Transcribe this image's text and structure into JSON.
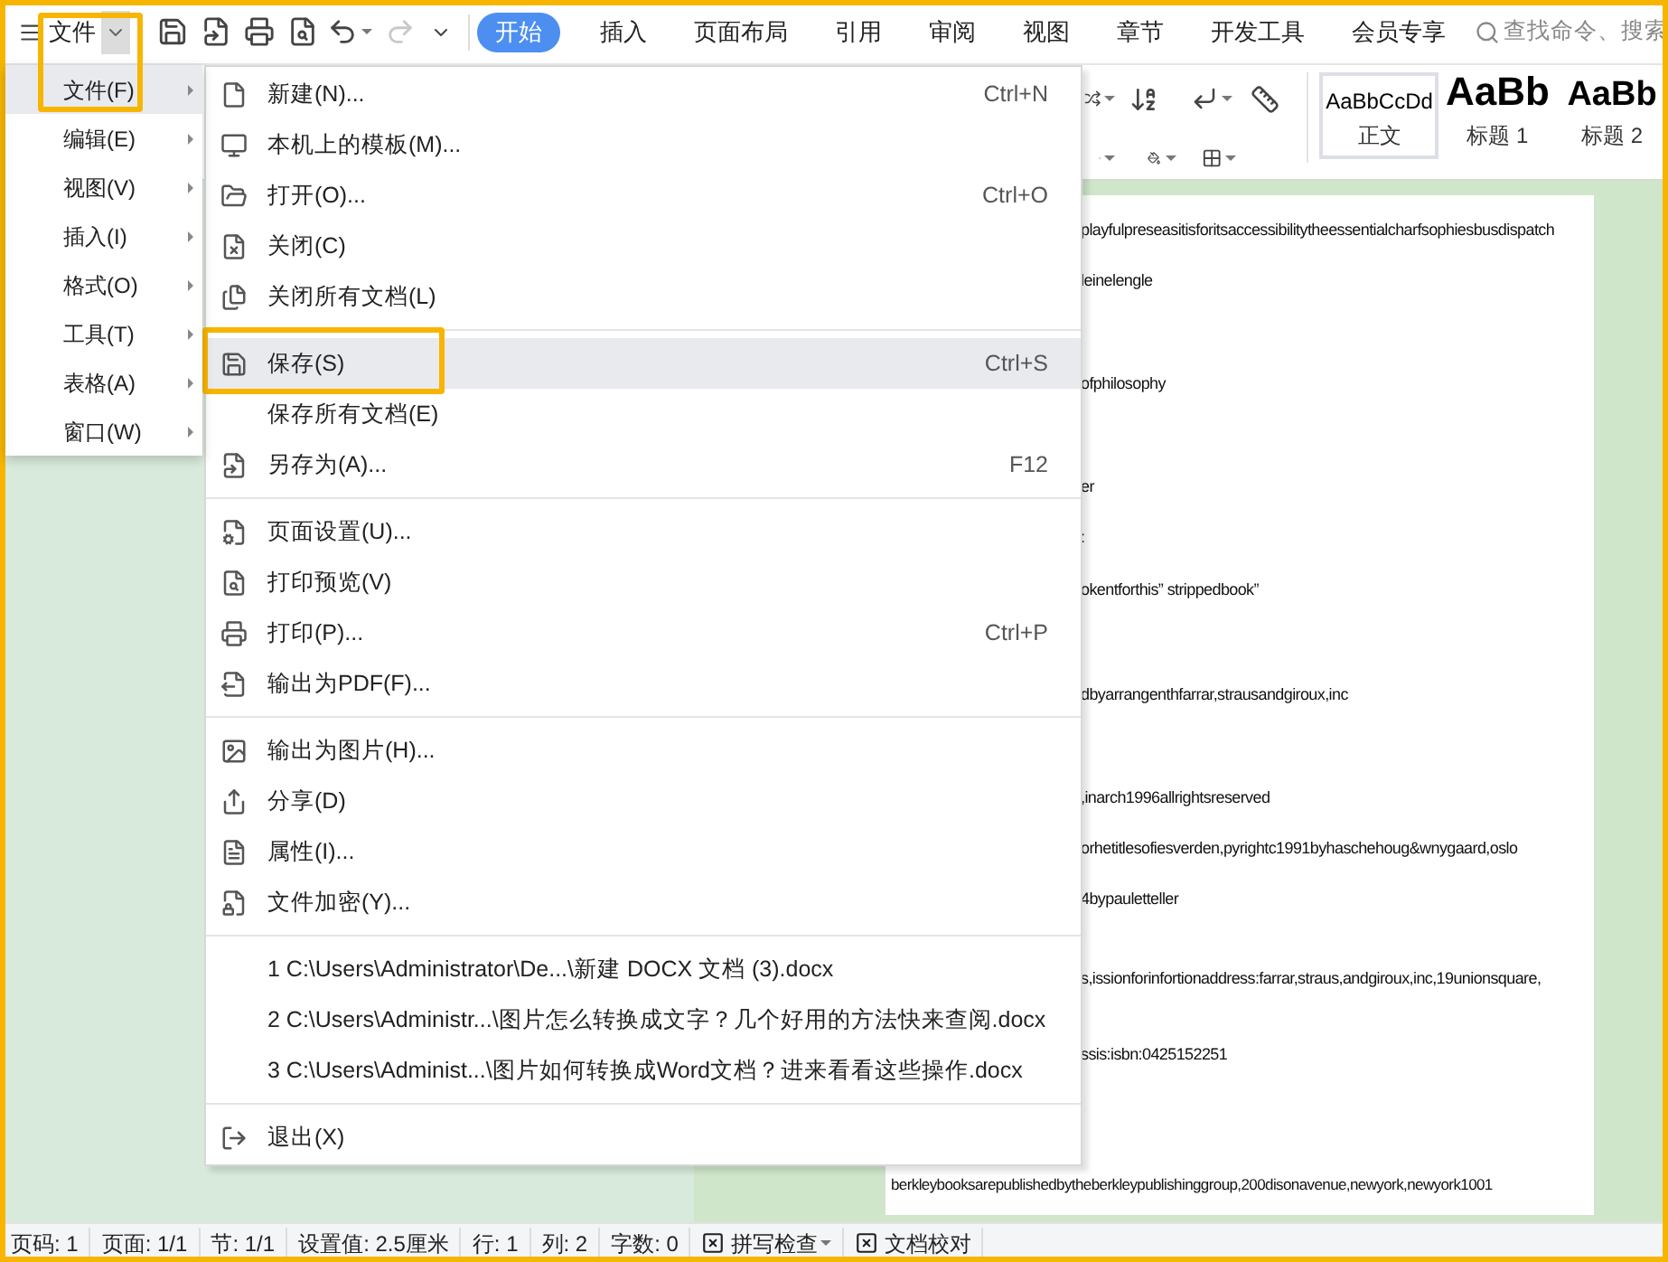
{
  "app_menu": {
    "label": "文件"
  },
  "tabs": [
    {
      "label": "开始",
      "selected": true
    },
    {
      "label": "插入",
      "selected": false
    },
    {
      "label": "页面布局",
      "selected": false
    },
    {
      "label": "引用",
      "selected": false
    },
    {
      "label": "审阅",
      "selected": false
    },
    {
      "label": "视图",
      "selected": false
    },
    {
      "label": "章节",
      "selected": false
    },
    {
      "label": "开发工具",
      "selected": false
    },
    {
      "label": "会员专享",
      "selected": false
    }
  ],
  "search": {
    "placeholder": "查找命令、搜索"
  },
  "styles": [
    {
      "preview": "AaBbCcDd",
      "label": "正文",
      "selected": true,
      "kind": "body"
    },
    {
      "preview": "AaBb",
      "label": "标题 1",
      "selected": false,
      "kind": "heading1"
    },
    {
      "preview": "AaBb",
      "label": "标题 2",
      "selected": false,
      "kind": "heading2"
    }
  ],
  "main_menu": [
    {
      "label": "文件(F)",
      "selected": true
    },
    {
      "label": "编辑(E)",
      "selected": false
    },
    {
      "label": "视图(V)",
      "selected": false
    },
    {
      "label": "插入(I)",
      "selected": false
    },
    {
      "label": "格式(O)",
      "selected": false
    },
    {
      "label": "工具(T)",
      "selected": false
    },
    {
      "label": "表格(A)",
      "selected": false
    },
    {
      "label": "窗口(W)",
      "selected": false
    }
  ],
  "file_menu": [
    [
      {
        "label": "新建(N)...",
        "shortcut": "Ctrl+N",
        "selected": false
      },
      {
        "label": "本机上的模板(M)...",
        "selected": false
      },
      {
        "label": "打开(O)...",
        "shortcut": "Ctrl+O",
        "selected": false
      },
      {
        "label": "关闭(C)",
        "selected": false
      },
      {
        "label": "关闭所有文档(L)",
        "selected": false
      }
    ],
    [
      {
        "label": "保存(S)",
        "shortcut": "Ctrl+S",
        "selected": true
      },
      {
        "label": "保存所有文档(E)",
        "selected": false
      },
      {
        "label": "另存为(A)...",
        "shortcut": "F12",
        "selected": false
      }
    ],
    [
      {
        "label": "页面设置(U)...",
        "selected": false
      },
      {
        "label": "打印预览(V)",
        "selected": false
      },
      {
        "label": "打印(P)...",
        "shortcut": "Ctrl+P",
        "selected": false
      },
      {
        "label": "输出为PDF(F)...",
        "selected": false
      }
    ],
    [
      {
        "label": "输出为图片(H)...",
        "selected": false
      },
      {
        "label": "分享(D)",
        "selected": false
      },
      {
        "label": "属性(I)...",
        "selected": false
      },
      {
        "label": "文件加密(Y)...",
        "selected": false
      }
    ],
    [
      {
        "label": "1 C:\\Users\\Administrator\\De...\\新建 DOCX 文档 (3).docx",
        "selected": false
      },
      {
        "label": "2 C:\\Users\\Administr...\\图片怎么转换成文字？几个好用的方法快来查阅.docx",
        "selected": false
      },
      {
        "label": "3 C:\\Users\\Administ...\\图片如何转换成Word文档？进来看看这些操作.docx",
        "selected": false
      }
    ],
    [
      {
        "label": "退出(X)",
        "selected": false
      }
    ]
  ],
  "document_lines": [
    {
      "text": "playfulpreseasitisforitsaccessibilitytheessentialcharfsophiesbusdispatch"
    },
    {
      "text": "leinelengle"
    },
    {
      "text": "ofphilosophy"
    },
    {
      "text": "er"
    },
    {
      "text": ":"
    },
    {
      "text": "okentforthis” strippedbook”"
    },
    {
      "text": "dbyarrangenthfarrar,strausandgiroux,inc"
    },
    {
      "text": ",inarch1996allrightsreserved"
    },
    {
      "text": "orhetitlesofiesverden,pyrightc1991byhaschehoug&wnygaard,oslo"
    },
    {
      "text": "4bypauletteller"
    },
    {
      "text": "s,issionforinfortionaddress:farrar,straus,andgiroux,inc,19unionsquare,"
    },
    {
      "text": "ssis:isbn:0425152251"
    },
    {
      "text": "berkleybooksarepublishedbytheberkleypublishinggroup,200disonavenue,newyork,newyork1001"
    }
  ],
  "status_bar": [
    {
      "text": "页码: 1",
      "kind": "text"
    },
    {
      "text": "页面: 1/1",
      "kind": "text"
    },
    {
      "text": "节: 1/1",
      "kind": "text"
    },
    {
      "text": "设置值: 2.5厘米",
      "kind": "text"
    },
    {
      "text": "行: 1",
      "kind": "text"
    },
    {
      "text": "列: 2",
      "kind": "text"
    },
    {
      "text": "字数: 0",
      "kind": "text"
    },
    {
      "text": "拼写检查",
      "kind": "toggle_menu"
    },
    {
      "text": "文档校对",
      "kind": "toggle"
    }
  ]
}
